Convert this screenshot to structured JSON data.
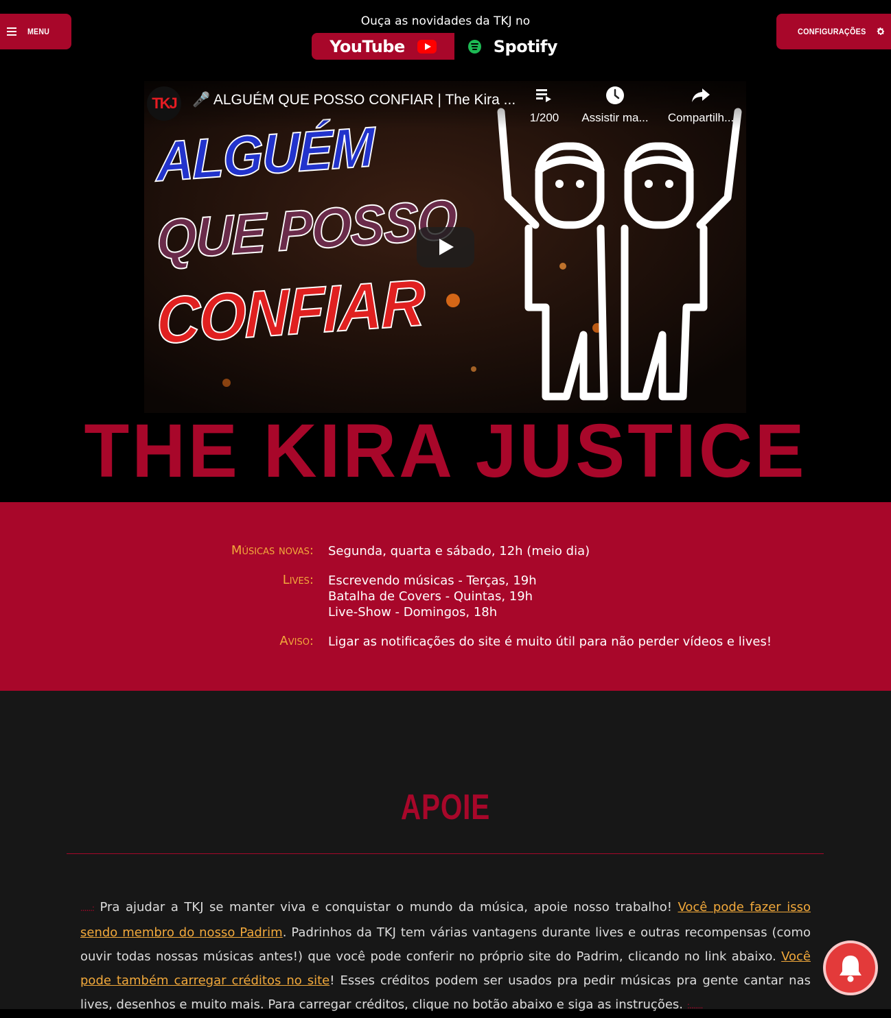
{
  "header": {
    "menu_label": "MENU",
    "config_label": "CONFIGURAÇÕES",
    "listen_text": "Ouça as novidades da TKJ no",
    "youtube_label": "YouTube",
    "spotify_label": "Spotify"
  },
  "video": {
    "channel_logo": "TKJ",
    "title": "🎤 ALGUÉM QUE POSSO CONFIAR | The Kira ...",
    "playlist_count": "1/200",
    "watch_later": "Assistir ma...",
    "share": "Compartilh...",
    "thumbnail_lines": [
      "ALGUÉM",
      "QUE POSSO",
      "CONFIAR"
    ]
  },
  "brand": "THE KIRA JUSTICE",
  "schedule": {
    "new_songs_label": "Músicas novas:",
    "new_songs_value": "Segunda, quarta e sábado, 12h (meio dia)",
    "lives_label": "Lives:",
    "lives_values": [
      "Escrevendo músicas - Terças, 19h",
      "Batalha de Covers - Quintas, 19h",
      "Live-Show - Domingos, 18h"
    ],
    "notice_label": "Aviso:",
    "notice_value": "Ligar as notificações do site é muito útil para não perder vídeos e lives!"
  },
  "apoie": {
    "title": "APOIE",
    "deco_left": "......:",
    "text_1": " Pra ajudar a TKJ se manter viva e conquistar o mundo da música, apoie nosso trabalho! ",
    "link_1": "Você pode fazer isso sendo membro do nosso Padrim",
    "text_2": ". Padrinhos da TKJ tem várias vantagens durante lives e outras recompensas (como ouvir todas nossas músicas antes!) que você pode conferir no próprio site do Padrim, clicando no link abaixo. ",
    "link_2": "Você pode também carregar créditos no site",
    "text_3": "! Esses créditos podem ser usados pra pedir músicas pra gente cantar nas lives, desenhos e muito mais. Para carregar créditos, clique no botão abaixo e siga as instruções. ",
    "deco_right": ":.......",
    "colors": {
      "accent": "#a8072a",
      "link": "#f2a93b"
    }
  },
  "icons": [
    "hamburger-icon",
    "gear-icon",
    "youtube-icon",
    "spotify-icon",
    "playlist-icon",
    "clock-icon",
    "share-icon",
    "play-icon",
    "bell-icon"
  ]
}
